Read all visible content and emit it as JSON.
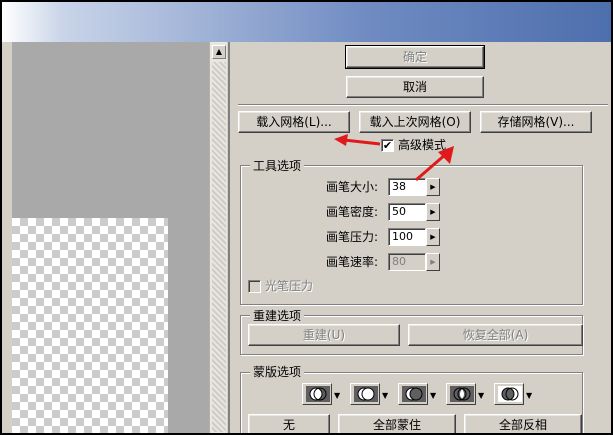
{
  "buttons": {
    "ok": "确定",
    "cancel": "取消",
    "load_mesh": "载入网格(L)...",
    "load_last_mesh": "载入上次网格(O)",
    "save_mesh": "存储网格(V)..."
  },
  "advanced_mode": {
    "label": "高级模式",
    "checked": true,
    "mark": "✔"
  },
  "tool_options": {
    "title": "工具选项",
    "fields": [
      {
        "label": "画笔大小:",
        "value": "38",
        "enabled": true
      },
      {
        "label": "画笔密度:",
        "value": "50",
        "enabled": true
      },
      {
        "label": "画笔压力:",
        "value": "100",
        "enabled": true
      },
      {
        "label": "画笔速率:",
        "value": "80",
        "enabled": false
      }
    ],
    "stylus_pressure": {
      "label": "光笔压力",
      "checked": false,
      "enabled": false
    }
  },
  "reconstruct_options": {
    "title": "重建选项",
    "reconstruct": "重建(U)",
    "restore_all": "恢复全部(A)"
  },
  "mask_options": {
    "title": "蒙版选项",
    "icons": [
      "replace-selection-icon",
      "add-to-selection-icon",
      "subtract-from-selection-icon",
      "intersect-selection-icon",
      "invert-selection-icon"
    ],
    "none": "无",
    "mask_all": "全部蒙住",
    "invert_all": "全部反相"
  },
  "scrollbar": {
    "up_glyph": "▲"
  },
  "spin_glyph": "▶"
}
